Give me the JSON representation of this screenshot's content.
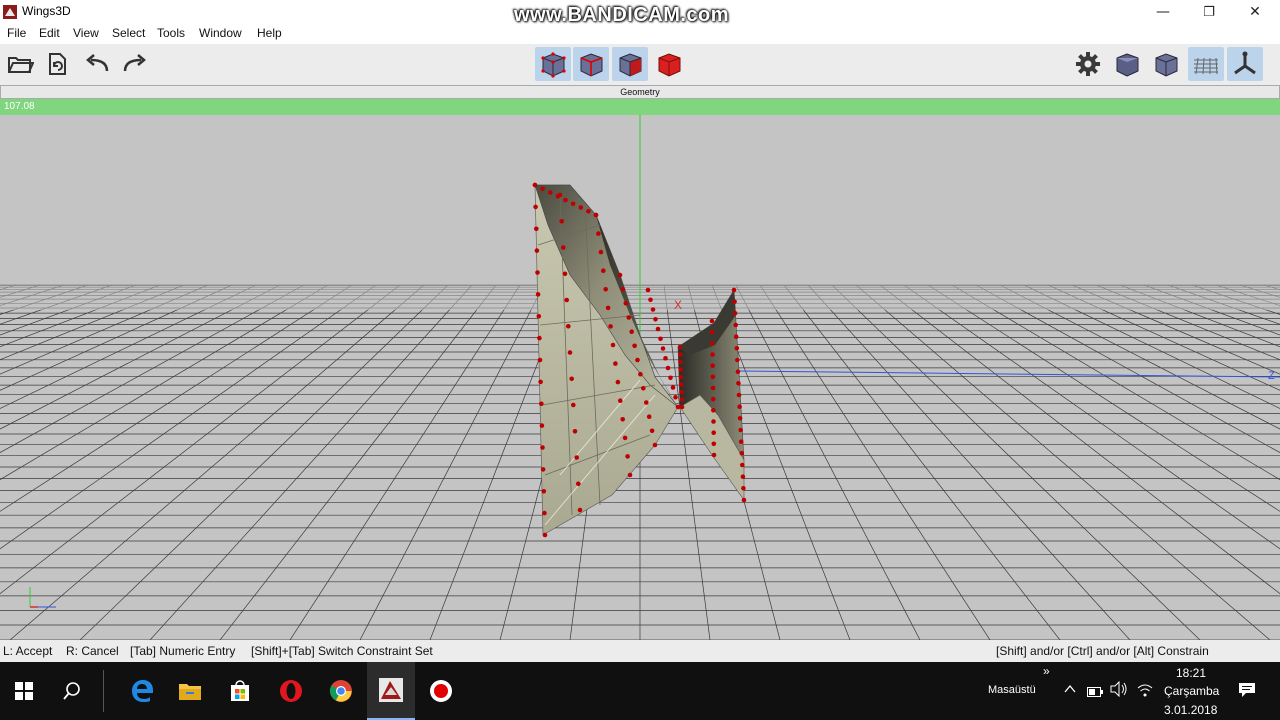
{
  "window": {
    "title": "Wings3D",
    "watermark": "www.BANDICAM.com",
    "controls": {
      "minimize": "—",
      "maximize": "❐",
      "close": "✕"
    }
  },
  "menu": [
    "File",
    "Edit",
    "View",
    "Select",
    "Tools",
    "Window",
    "Help"
  ],
  "toolbar": {
    "left_icons": [
      "open-folder-icon",
      "save-icon",
      "undo-icon",
      "redo-icon"
    ],
    "selection_modes": [
      {
        "name": "vertex-mode-icon",
        "selected": true
      },
      {
        "name": "edge-mode-icon",
        "selected": true
      },
      {
        "name": "face-mode-icon",
        "selected": true
      },
      {
        "name": "body-mode-icon",
        "selected": false
      }
    ],
    "right_icons": [
      "preferences-gear-icon",
      "smooth-cube-icon",
      "flat-cube-icon",
      "ground-grid-icon",
      "axes-icon"
    ]
  },
  "geometry": {
    "title": "Geometry",
    "info": "107.08",
    "axis_label_x": "X",
    "axis_label_z": "Z",
    "colors": {
      "background": "#c4c4c4",
      "grid": "#3a3a3a",
      "vertex": "#c00000",
      "surface_light": "#b9b8a0",
      "surface_dark": "#3c3c34",
      "info_bar": "#7fd67f"
    }
  },
  "statusbar": {
    "accept": "L: Accept",
    "cancel": "R: Cancel",
    "numeric": "[Tab] Numeric Entry",
    "switch": "[Shift]+[Tab] Switch Constraint Set",
    "constrain": "[Shift] and/or [Ctrl] and/or [Alt] Constrain"
  },
  "taskbar": {
    "apps": [
      "start-windows-icon",
      "search-icon",
      "edge-browser-icon",
      "file-explorer-icon",
      "store-icon",
      "opera-icon",
      "chrome-icon",
      "wings3d-icon",
      "bandicam-record-icon"
    ],
    "desktop_label": "Masaüstü",
    "time": "18:21",
    "day": "Çarşamba",
    "date": "3.01.2018"
  }
}
